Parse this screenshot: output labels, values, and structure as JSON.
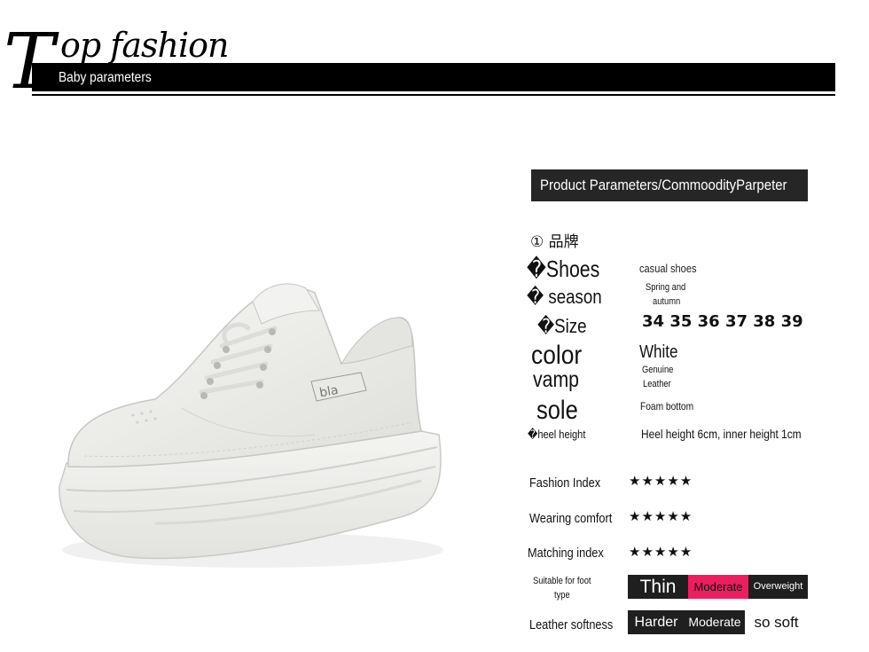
{
  "header": {
    "title_initial": "T",
    "title_rest": "op fashion",
    "subtitle": "Baby parameters"
  },
  "params": {
    "banner": "Product Parameters/CommoodityParpeter",
    "brand_label": "① 品牌",
    "shoes_label": "�Shoes",
    "shoes_value": "casual shoes",
    "season_label": "� season",
    "season_value_line1": "Spring and",
    "season_value_line2": "autumn",
    "size_label": "�Size",
    "size_value": "34 35 36 37 38 39",
    "color_label": "color",
    "color_value": "White",
    "vamp_label": "vamp",
    "vamp_value_line1": "Genuine",
    "vamp_value_line2": "Leather",
    "sole_label": "sole",
    "sole_value": "Foam bottom",
    "heel_label": "�heel height",
    "heel_value": "Heel height 6cm, inner height 1cm"
  },
  "ratings": [
    {
      "label": "Fashion Index",
      "stars": "★★★★★"
    },
    {
      "label": "Wearing comfort",
      "stars": "★★★★★"
    },
    {
      "label": "Matching index",
      "stars": "★★★★★"
    }
  ],
  "foot_type": {
    "label_line1": "Suitable for foot",
    "label_line2": "type",
    "options": [
      "Thin",
      "Moderate",
      "Overweight"
    ],
    "selected": "Moderate"
  },
  "softness": {
    "label": "Leather softness",
    "options": [
      "Harder",
      "Moderate",
      "so soft"
    ],
    "selected": "so soft"
  },
  "colors": {
    "highlight": "#ea1f5f",
    "dark_bar": "#1f1f1f",
    "shoe": "#eeeeec"
  }
}
